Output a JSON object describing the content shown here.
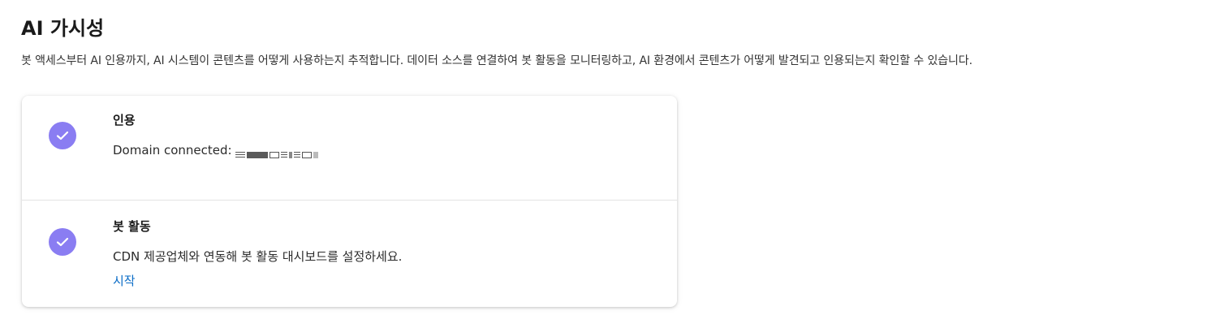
{
  "header": {
    "title": "AI 가시성",
    "description": "봇 액세스부터 AI 인용까지, AI 시스템이 콘텐츠를 어떻게 사용하는지 추적합니다. 데이터 소스를 연결하여 봇 활동을 모니터링하고, AI 환경에서 콘텐츠가 어떻게 발견되고 인용되는지 확인할 수 있습니다."
  },
  "cards": [
    {
      "title": "인용",
      "text": "Domain connected:",
      "status_icon": "check-icon"
    },
    {
      "title": "봇 활동",
      "text": "CDN 제공업체와 연동해 봇 활동 대시보드를 설정하세요.",
      "link": "시작",
      "status_icon": "check-icon"
    }
  ],
  "colors": {
    "check_bg": "#8a7df2",
    "link": "#0a6cc7"
  }
}
